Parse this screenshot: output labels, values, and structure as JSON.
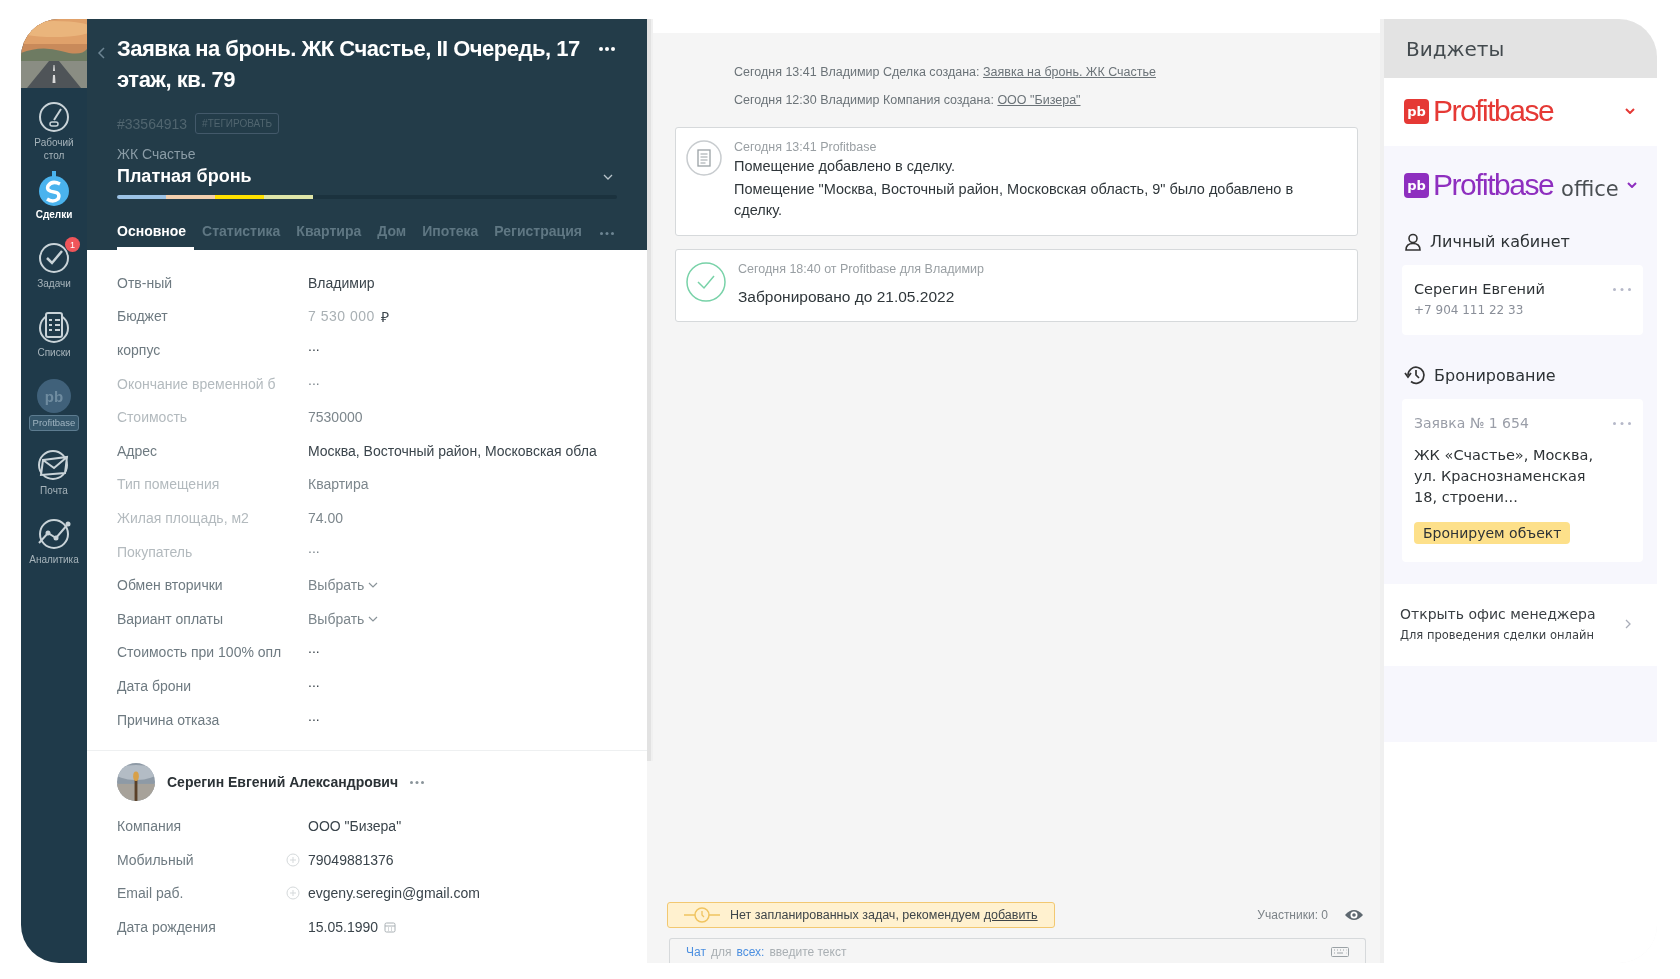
{
  "nav": {
    "items": [
      {
        "label": "Рабочий стол",
        "kind": "gauge",
        "selected": false
      },
      {
        "label": "Сделки",
        "kind": "deals",
        "selected": true
      },
      {
        "label": "Задачи",
        "kind": "check",
        "selected": false,
        "badge": "1"
      },
      {
        "label": "Списки",
        "kind": "list",
        "selected": false
      },
      {
        "label": "Profitbase",
        "kind": "pb",
        "selected": false,
        "icon_text": "pb"
      },
      {
        "label": "Почта",
        "kind": "mail",
        "selected": false
      },
      {
        "label": "Аналитика",
        "kind": "chart",
        "selected": false
      }
    ]
  },
  "deal": {
    "title": "Заявка на бронь. ЖК Счастье, II Очередь, 17 этаж, кв. 79",
    "id": "#33564913",
    "tag_button": "#ТЕГИРОВАТЬ",
    "pipeline": "ЖК Счастье",
    "status": "Платная бронь",
    "stages": [
      {
        "color": "#9cc3e6"
      },
      {
        "color": "#f2cfae"
      },
      {
        "color": "#ffe100"
      },
      {
        "color": "#dfe6a8"
      }
    ],
    "tabs": [
      {
        "label": "Основное",
        "selected": true
      },
      {
        "label": "Статистика",
        "selected": false
      },
      {
        "label": "Квартира",
        "selected": false
      },
      {
        "label": "Дом",
        "selected": false
      },
      {
        "label": "Ипотека",
        "selected": false
      },
      {
        "label": "Регистрация",
        "selected": false
      }
    ],
    "fields": [
      {
        "label": "Отв-ный",
        "value": "Владимир",
        "kind": "text",
        "disabled": false
      },
      {
        "label": "Бюджет",
        "value": "7 530 000",
        "currency": "₽",
        "kind": "currency",
        "disabled": false
      },
      {
        "label": "корпус",
        "value": "...",
        "kind": "empty",
        "disabled": false
      },
      {
        "label": "Окончание временной б",
        "value": "...",
        "kind": "empty",
        "disabled": true
      },
      {
        "label": "Стоимость",
        "value": "7530000",
        "kind": "text",
        "disabled": true
      },
      {
        "label": "Адрес",
        "value": "Москва, Восточный район, Московская обла",
        "kind": "text",
        "disabled": false
      },
      {
        "label": "Тип помещения",
        "value": "Квартира",
        "kind": "text",
        "disabled": true
      },
      {
        "label": "Жилая площадь, м2",
        "value": "74.00",
        "kind": "text",
        "disabled": true
      },
      {
        "label": "Покупатель",
        "value": "...",
        "kind": "empty",
        "disabled": true
      },
      {
        "label": "Обмен вторички",
        "value": "Выбрать",
        "kind": "select",
        "disabled": false
      },
      {
        "label": "Вариант оплаты",
        "value": "Выбрать",
        "kind": "select",
        "disabled": false
      },
      {
        "label": "Стоимость при 100% опл",
        "value": "...",
        "kind": "empty",
        "disabled": false
      },
      {
        "label": "Дата брони",
        "value": "...",
        "kind": "empty",
        "disabled": false
      },
      {
        "label": "Причина отказа",
        "value": "...",
        "kind": "empty",
        "disabled": false
      }
    ]
  },
  "contact": {
    "name": "Серегин Евгений Александрович",
    "fields": [
      {
        "label": "Компания",
        "value": "ООО \"Бизера\"",
        "kind": "text"
      },
      {
        "label": "Мобильный",
        "value": "79049881376",
        "kind": "add"
      },
      {
        "label": "Email раб.",
        "value": "evgeny.seregin@gmail.com",
        "kind": "add"
      },
      {
        "label": "Дата рождения",
        "value": "15.05.1990",
        "kind": "date"
      }
    ]
  },
  "feed": {
    "events": [
      {
        "text": "Сегодня 13:41 Владимир Сделка создана:",
        "link": "Заявка на бронь. ЖК Счастье"
      },
      {
        "text": "Сегодня 12:30 Владимир Компания создана:",
        "link": "ООО \"Бизера\""
      }
    ],
    "notes": [
      {
        "kind": "note",
        "meta": "Сегодня 13:41 Profitbase",
        "lines": [
          "Помещение добавлено в сделку.",
          "Помещение \"Москва, Восточный район, Московская область, 9\" было добавлено в сделку."
        ]
      },
      {
        "kind": "done",
        "meta": "Сегодня 18:40 от Profitbase для Владимир",
        "lines": [
          "Забронировано до 21.05.2022"
        ]
      }
    ],
    "task_notice": {
      "text": "Нет запланированных задач, рекомендуем",
      "link": "добавить"
    },
    "participants": "Участники: 0",
    "chat": {
      "mode": "Чат",
      "for": "для",
      "audience": "всех:",
      "placeholder": "введите текст"
    }
  },
  "widgets": {
    "title": "Виджеты",
    "profitbase": {
      "mark": "pb",
      "name": "Profitbase"
    },
    "office": {
      "mark": "pb",
      "name": "Profitbase",
      "suffix": "office"
    },
    "account": {
      "title": "Личный кабинет",
      "name": "Серегин Евгений",
      "phone": "+7 904 111 22 33"
    },
    "booking": {
      "title": "Бронирование",
      "number": "Заявка № 1 654",
      "address": "ЖК «Счастье», Москва, ул. Краснознаменская 18, строени...",
      "status": "Бронируем объект"
    },
    "manager": {
      "title": "Открыть офис менеджера",
      "subtitle": "Для проведения сделки онлайн"
    }
  }
}
